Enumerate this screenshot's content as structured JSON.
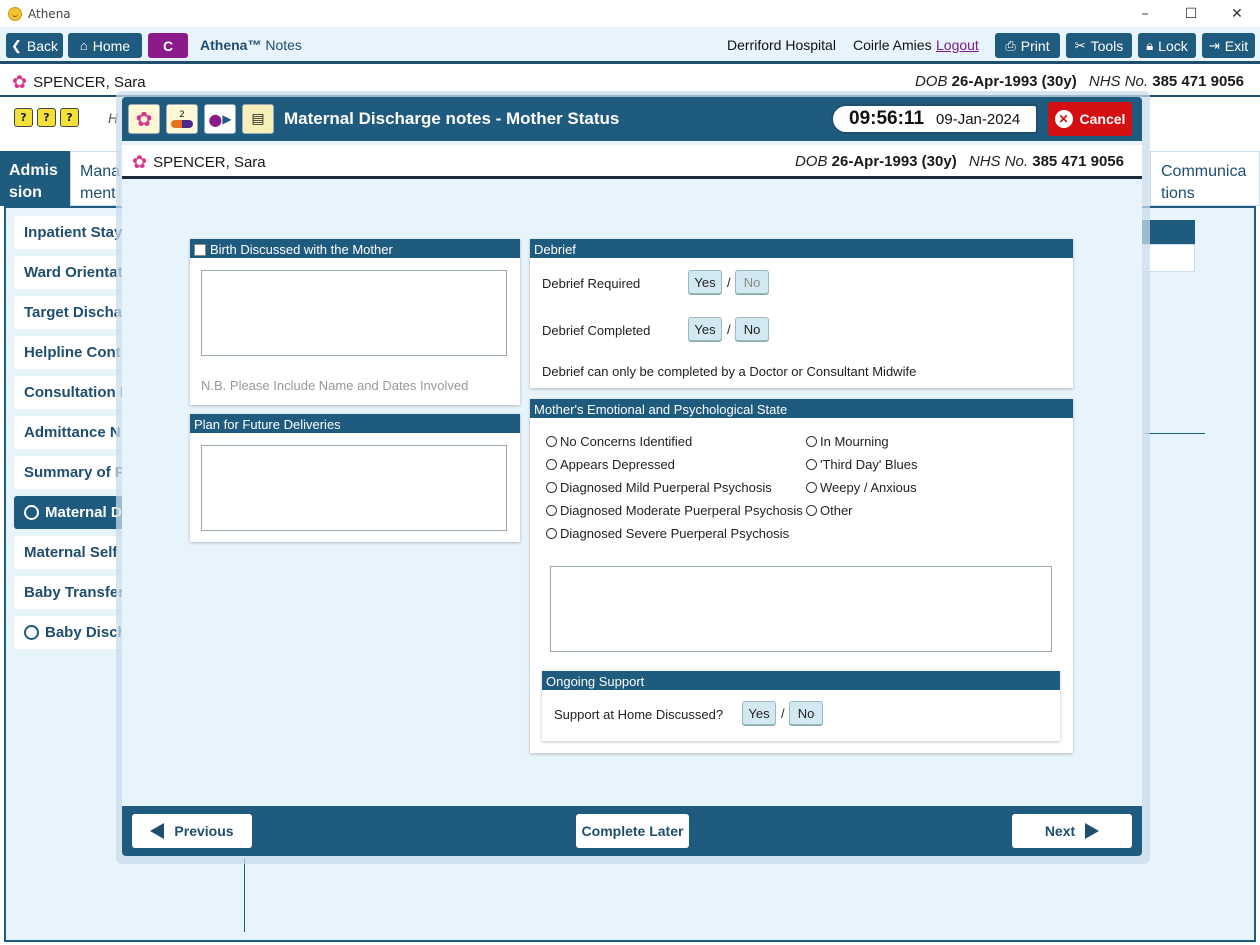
{
  "window": {
    "title": "Athena",
    "controls": {
      "minimize": "–",
      "maximize": "☐",
      "close": "✕"
    }
  },
  "toolbar": {
    "back": "Back",
    "home": "Home",
    "c_button": "C",
    "brand": "Athena™",
    "brand_suffix": "Notes",
    "hospital": "Derriford Hospital",
    "user": "Coirle Amies",
    "logout": "Logout",
    "print": "Print",
    "tools": "Tools",
    "lock": "Lock",
    "exit": "Exit"
  },
  "patient": {
    "name": "SPENCER, Sara",
    "dob_label": "DOB",
    "dob": "26-Apr-1993 (30y)",
    "nhs_label": "NHS No.",
    "nhs": "385 471 9056"
  },
  "background": {
    "small_icons": [
      "?",
      "?",
      "?"
    ],
    "hidden_letter": "H",
    "tabs": {
      "admission": "Admis sion",
      "management": "Mana ment",
      "communications": "Communica tions"
    },
    "side_items": [
      {
        "label": "Inpatient Stay",
        "circle": false,
        "active": false
      },
      {
        "label": "Ward Orientat",
        "circle": false,
        "active": false
      },
      {
        "label": "Target Dischar",
        "circle": false,
        "active": false
      },
      {
        "label": "Helpline Cont",
        "circle": false,
        "active": false
      },
      {
        "label": "Consultation I",
        "circle": false,
        "active": false
      },
      {
        "label": "Admittance N",
        "circle": false,
        "active": false
      },
      {
        "label": "Summary of P",
        "circle": false,
        "active": false
      },
      {
        "label": "Maternal Di",
        "circle": true,
        "active": true
      },
      {
        "label": "Maternal Self",
        "circle": false,
        "active": false
      },
      {
        "label": "Baby Transfer",
        "circle": false,
        "active": false
      },
      {
        "label": "Baby Discha",
        "circle": true,
        "active": false
      }
    ]
  },
  "modal": {
    "title": "Maternal Discharge notes - Mother Status",
    "time": "09:56:11",
    "date": "09-Jan-2024",
    "cancel": "Cancel",
    "header_icons": [
      "flower-icon",
      "medication-icon",
      "person-arrow-icon",
      "notepad-icon"
    ],
    "medication_badge": "2",
    "birth_discussed": {
      "title": "Birth Discussed with the Mother",
      "hint": "N.B. Please Include Name and Dates Involved"
    },
    "plan_future": {
      "title": "Plan for Future Deliveries"
    },
    "debrief": {
      "title": "Debrief",
      "required_label": "Debrief Required",
      "completed_label": "Debrief Completed",
      "yes": "Yes",
      "no": "No",
      "slash": "/",
      "note": "Debrief can only be completed by a Doctor or Consultant Midwife"
    },
    "emotional": {
      "title": "Mother's Emotional and Psychological State",
      "options_left": [
        "No Concerns Identified",
        "Appears Depressed",
        "Diagnosed Mild Puerperal Psychosis",
        "Diagnosed Moderate Puerperal Psychosis",
        "Diagnosed Severe Puerperal Psychosis"
      ],
      "options_right": [
        "In Mourning",
        "'Third Day' Blues",
        "Weepy / Anxious",
        "Other"
      ]
    },
    "ongoing_support": {
      "title": "Ongoing Support",
      "label": "Support at Home Discussed?",
      "yes": "Yes",
      "no": "No",
      "slash": "/"
    },
    "footer": {
      "previous": "Previous",
      "complete_later": "Complete Later",
      "next": "Next"
    }
  },
  "colors": {
    "primary": "#1f5a7f",
    "accent_purple": "#8b1a8b",
    "cancel_red": "#d40f12",
    "panel_bg": "#e8f4fb"
  }
}
